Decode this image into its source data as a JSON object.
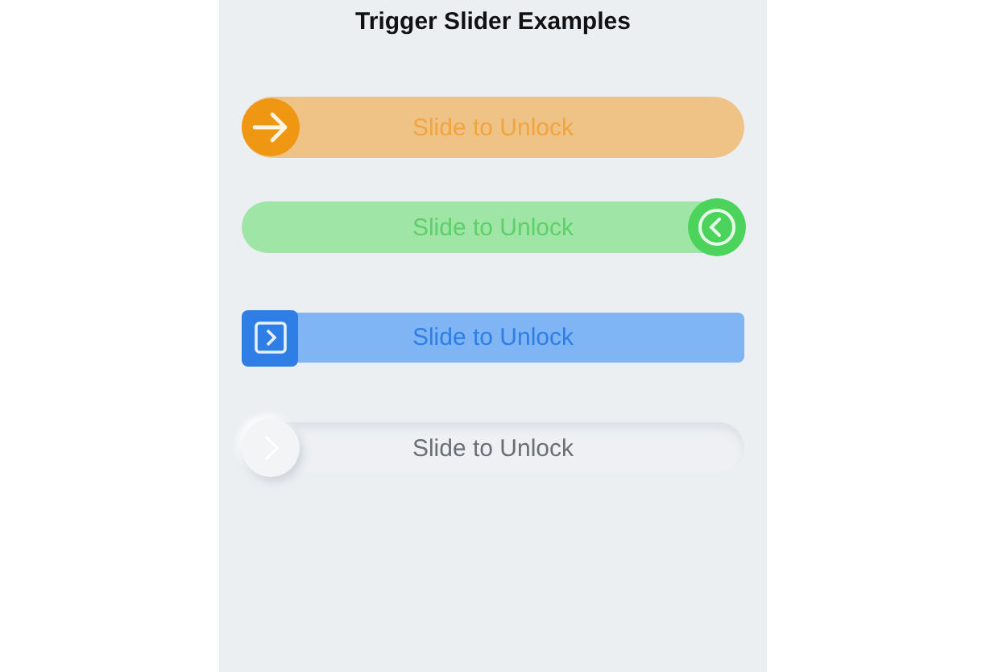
{
  "title": "Trigger Slider Examples",
  "sliders": [
    {
      "kind": "orange",
      "label": "Slide to Unlock"
    },
    {
      "kind": "green",
      "label": "Slide to Unlock"
    },
    {
      "kind": "blue",
      "label": "Slide to Unlock"
    },
    {
      "kind": "soft",
      "label": "Slide to Unlock"
    }
  ]
}
